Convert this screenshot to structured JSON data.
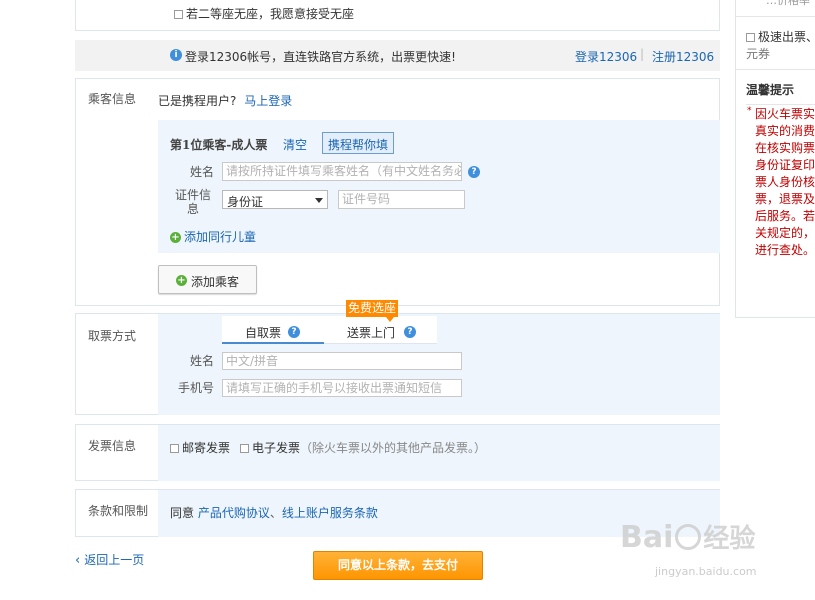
{
  "seat": {
    "no_seat_text": "若二等座无座，我愿意接受无座"
  },
  "login_bar": {
    "info": "登录12306帐号，直连铁路官方系统，出票更快速!",
    "login_link": "登录12306",
    "separator": "|",
    "register_link": "注册12306"
  },
  "passenger": {
    "section_label": "乘客信息",
    "member_prompt": "已是携程用户?",
    "login_link": "马上登录",
    "card_title": "第1位乘客-成人票",
    "clear_link": "清空",
    "autofill_button": "携程帮你填",
    "name_label": "姓名",
    "name_placeholder": "请按所持证件填写乘客姓名（有中文姓名务必填写中文）",
    "id_label_line1": "证件信",
    "id_label_line2": "息",
    "id_type_selected": "身份证",
    "id_number_placeholder": "证件号码",
    "add_child_link": "添加同行儿童",
    "add_passenger_button": "添加乘客"
  },
  "pickup": {
    "section_label": "取票方式",
    "free_badge": "免费选座",
    "tab_self": "自取票",
    "tab_delivery": "送票上门",
    "name_label": "姓名",
    "name_placeholder": "中文/拼音",
    "phone_label": "手机号",
    "phone_placeholder": "请填写正确的手机号以接收出票通知短信"
  },
  "invoice": {
    "section_label": "发票信息",
    "mail_invoice": "邮寄发票",
    "e_invoice": "电子发票",
    "note": "（除火车票以外的其他产品发票。）"
  },
  "terms": {
    "section_label": "条款和限制",
    "agree": "同意",
    "link1": "产品代购协议",
    "separator": "、",
    "link2": "线上账户服务条款"
  },
  "footer": {
    "back_link": "返回上一页",
    "pay_button": "同意以上条款，去支付"
  },
  "sidebar": {
    "top_partial": "…价格率",
    "speed_line1": "极速出票、",
    "speed_line2": "元券",
    "tips_title": "温馨提示",
    "tips_lines": [
      "因火车票实",
      "真实的消费",
      "在核实购票",
      "身份证复印",
      "票人身份核",
      "票，退票及",
      "后服务。若",
      "关规定的，",
      "进行查处。"
    ]
  },
  "watermark": {
    "brand": "Bai",
    "brand2": "经验",
    "url": "jingyan.baidu.com"
  },
  "colors": {
    "accent": "#ff8a00",
    "link": "#1a66b3",
    "panel": "#eef5fc",
    "warning_red": "#c00000"
  }
}
